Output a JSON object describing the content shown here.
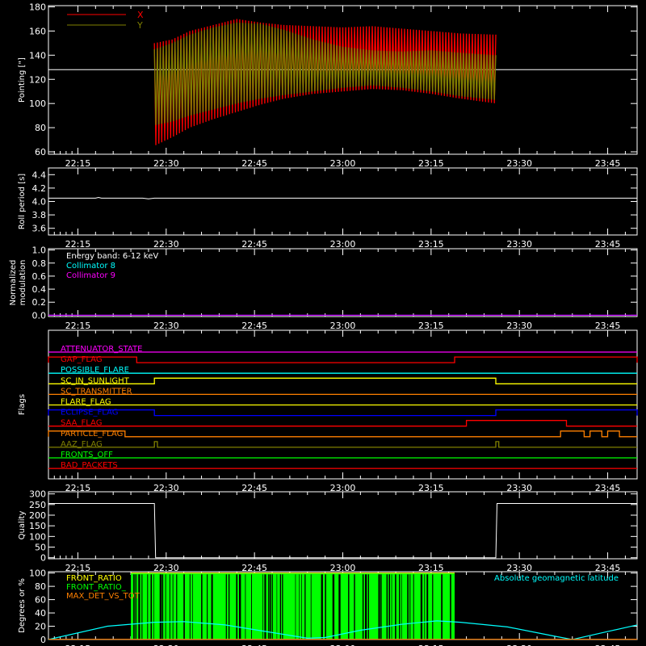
{
  "time_ticks": [
    "22:15",
    "22:30",
    "22:45",
    "23:00",
    "23:15",
    "23:30",
    "23:45"
  ],
  "chart_data": [
    {
      "id": "pointing",
      "type": "line",
      "xlabel": "",
      "ylabel": "Pointing [\"]",
      "ylim": [
        58,
        181
      ],
      "yticks": [
        60,
        80,
        100,
        120,
        140,
        160,
        180
      ],
      "xlim": [
        "22:10",
        "23:50"
      ],
      "reference_line": 128,
      "legend": {
        "placement": "top-left",
        "entries": [
          {
            "name": "X",
            "color": "#ff0000"
          },
          {
            "name": "Y",
            "color": "#808000"
          }
        ]
      },
      "data_start": "22:28",
      "data_end": "23:26",
      "series": [
        {
          "name": "X",
          "color": "#ff0000",
          "upper": [
            [
              "22:28",
              150
            ],
            [
              "22:31",
              153
            ],
            [
              "22:34",
              160
            ],
            [
              "22:38",
              165
            ],
            [
              "22:42",
              170
            ],
            [
              "22:46",
              167
            ],
            [
              "22:50",
              165
            ],
            [
              "22:55",
              164
            ],
            [
              "23:00",
              163
            ],
            [
              "23:05",
              164
            ],
            [
              "23:10",
              162
            ],
            [
              "23:15",
              160
            ],
            [
              "23:20",
              158
            ],
            [
              "23:26",
              157
            ]
          ],
          "lower": [
            [
              "22:28",
              65
            ],
            [
              "22:31",
              72
            ],
            [
              "22:34",
              80
            ],
            [
              "22:38",
              87
            ],
            [
              "22:42",
              93
            ],
            [
              "22:46",
              99
            ],
            [
              "22:50",
              104
            ],
            [
              "22:55",
              108
            ],
            [
              "23:00",
              110
            ],
            [
              "23:05",
              112
            ],
            [
              "23:10",
              111
            ],
            [
              "23:15",
              108
            ],
            [
              "23:20",
              104
            ],
            [
              "23:26",
              100
            ]
          ]
        },
        {
          "name": "Y",
          "color": "#808000",
          "upper": [
            [
              "22:28",
              145
            ],
            [
              "22:31",
              150
            ],
            [
              "22:34",
              157
            ],
            [
              "22:38",
              163
            ],
            [
              "22:42",
              167
            ],
            [
              "22:46",
              166
            ],
            [
              "22:50",
              161
            ],
            [
              "22:55",
              153
            ],
            [
              "23:00",
              147
            ],
            [
              "23:05",
              144
            ],
            [
              "23:10",
              143
            ],
            [
              "23:15",
              144
            ],
            [
              "23:20",
              142
            ],
            [
              "23:26",
              140
            ]
          ],
          "lower": [
            [
              "22:28",
              82
            ],
            [
              "22:31",
              85
            ],
            [
              "22:34",
              90
            ],
            [
              "22:38",
              95
            ],
            [
              "22:42",
              100
            ],
            [
              "22:46",
              104
            ],
            [
              "22:50",
              107
            ],
            [
              "22:55",
              110
            ],
            [
              "23:00",
              113
            ],
            [
              "23:05",
              115
            ],
            [
              "23:10",
              113
            ],
            [
              "23:15",
              110
            ],
            [
              "23:20",
              106
            ],
            [
              "23:26",
              103
            ]
          ]
        }
      ]
    },
    {
      "id": "roll",
      "type": "line",
      "ylabel": "Roll period [s]",
      "ylim": [
        3.5,
        4.5
      ],
      "yticks": [
        3.6,
        3.8,
        4.0,
        4.2,
        4.4
      ],
      "series": [
        {
          "name": "",
          "color": "#ffffff",
          "points": [
            [
              "22:10",
              4.05
            ],
            [
              "22:18",
              4.05
            ],
            [
              "22:18.5",
              4.06
            ],
            [
              "22:19",
              4.05
            ],
            [
              "22:26",
              4.05
            ],
            [
              "22:27",
              4.04
            ],
            [
              "22:28",
              4.05
            ],
            [
              "23:50",
              4.05
            ]
          ]
        }
      ]
    },
    {
      "id": "modulation",
      "type": "line",
      "ylabel": [
        "Normalized",
        "modulation"
      ],
      "ylim": [
        -0.02,
        1.02
      ],
      "yticks": [
        0.0,
        0.2,
        0.4,
        0.6,
        0.8,
        1.0
      ],
      "annotations": [
        {
          "text": "Energy band: 6-12 keV",
          "color": "#ffffff"
        },
        {
          "text": "Collimator 8",
          "color": "#00ffff"
        },
        {
          "text": "Collimator 9",
          "color": "#ff00ff"
        }
      ],
      "series": [
        {
          "name": "",
          "color": "#c000ff",
          "points": [
            [
              "22:10",
              0.0
            ],
            [
              "23:50",
              0.0
            ]
          ]
        }
      ]
    },
    {
      "id": "flags",
      "type": "line",
      "ylabel": "Flags",
      "flags": [
        {
          "label": "ATTENUATOR_STATE",
          "color": "#ff00ff",
          "baseline": "low",
          "on_intervals": []
        },
        {
          "label": "GAP_FLAG",
          "color": "#ff0000",
          "baseline": "low",
          "on_intervals": [
            [
              "22:10",
              "22:25"
            ],
            [
              "23:19",
              "23:50"
            ]
          ]
        },
        {
          "label": "POSSIBLE_FLARE",
          "color": "#00ffff",
          "baseline": "low",
          "on_intervals": []
        },
        {
          "label": "SC_IN_SUNLIGHT",
          "color": "#ffff00",
          "baseline": "low",
          "on_intervals": [
            [
              "22:28",
              "23:26"
            ]
          ]
        },
        {
          "label": "SC_TRANSMITTER",
          "color": "#ff8000",
          "baseline": "low",
          "on_intervals": []
        },
        {
          "label": "FLARE_FLAG",
          "color": "#ffff00",
          "baseline": "low",
          "on_intervals": []
        },
        {
          "label": "ECLIPSE_FLAG",
          "color": "#0000ff",
          "baseline": "low",
          "on_intervals": [
            [
              "22:10",
              "22:28"
            ],
            [
              "23:26",
              "23:50"
            ]
          ]
        },
        {
          "label": "SAA_FLAG",
          "color": "#ff0000",
          "baseline": "low",
          "on_intervals": [
            [
              "23:21",
              "23:38"
            ]
          ]
        },
        {
          "label": "PARTICLE_FLAG",
          "color": "#ff8000",
          "baseline": "low",
          "on_intervals": [
            [
              "22:10",
              "22:23"
            ],
            [
              "23:37",
              "23:41"
            ],
            [
              "23:42",
              "23:44"
            ],
            [
              "23:45",
              "23:47"
            ]
          ]
        },
        {
          "label": "AAZ_FLAG",
          "color": "#808000",
          "baseline": "low",
          "on_intervals": [
            [
              "22:28",
              "22:28.5"
            ],
            [
              "23:26",
              "23:26.5"
            ]
          ]
        },
        {
          "label": "FRONTS_OFF",
          "color": "#00ff00",
          "baseline": "low",
          "on_intervals": []
        },
        {
          "label": "BAD_PACKETS",
          "color": "#ff0000",
          "baseline": "low",
          "on_intervals": []
        }
      ]
    },
    {
      "id": "quality",
      "type": "line",
      "ylabel": "Quality",
      "ylim": [
        -5,
        310
      ],
      "yticks": [
        0,
        50,
        100,
        150,
        200,
        250,
        300
      ],
      "series": [
        {
          "name": "",
          "color": "#ffffff",
          "points": [
            [
              "22:10",
              255
            ],
            [
              "22:28",
              255
            ],
            [
              "22:28.2",
              0
            ],
            [
              "23:26",
              0
            ],
            [
              "23:26.2",
              255
            ],
            [
              "23:50",
              255
            ]
          ]
        }
      ]
    },
    {
      "id": "ratios",
      "type": "line",
      "ylabel": "Degrees or %",
      "ylim": [
        0,
        102
      ],
      "yticks": [
        0,
        20,
        40,
        60,
        80,
        100
      ],
      "legend": {
        "placement": "top-left",
        "entries": [
          {
            "name": "FRONT_RATIO",
            "color": "#ffff00"
          },
          {
            "name": "FRONT_RATIO_",
            "color": "#00ff00"
          },
          {
            "name": "MAX_DET_VS_TOT",
            "color": "#ff8000"
          }
        ]
      },
      "annotation": {
        "text": "Absolute geomagnetic latitude",
        "color": "#00ffff"
      },
      "green_band": [
        "22:24",
        "23:19"
      ],
      "latitude": {
        "color": "#00ffff",
        "points": [
          [
            "22:10",
            0
          ],
          [
            "22:20",
            20
          ],
          [
            "22:28",
            26
          ],
          [
            "22:33",
            27
          ],
          [
            "22:40",
            22
          ],
          [
            "22:47",
            12
          ],
          [
            "22:54",
            2
          ],
          [
            "22:57",
            3
          ],
          [
            "23:03",
            14
          ],
          [
            "23:10",
            23
          ],
          [
            "23:16",
            28
          ],
          [
            "23:20",
            26
          ],
          [
            "23:28",
            19
          ],
          [
            "23:36",
            5
          ],
          [
            "23:39",
            0
          ],
          [
            "23:45",
            12
          ],
          [
            "23:50",
            22
          ]
        ]
      }
    }
  ]
}
